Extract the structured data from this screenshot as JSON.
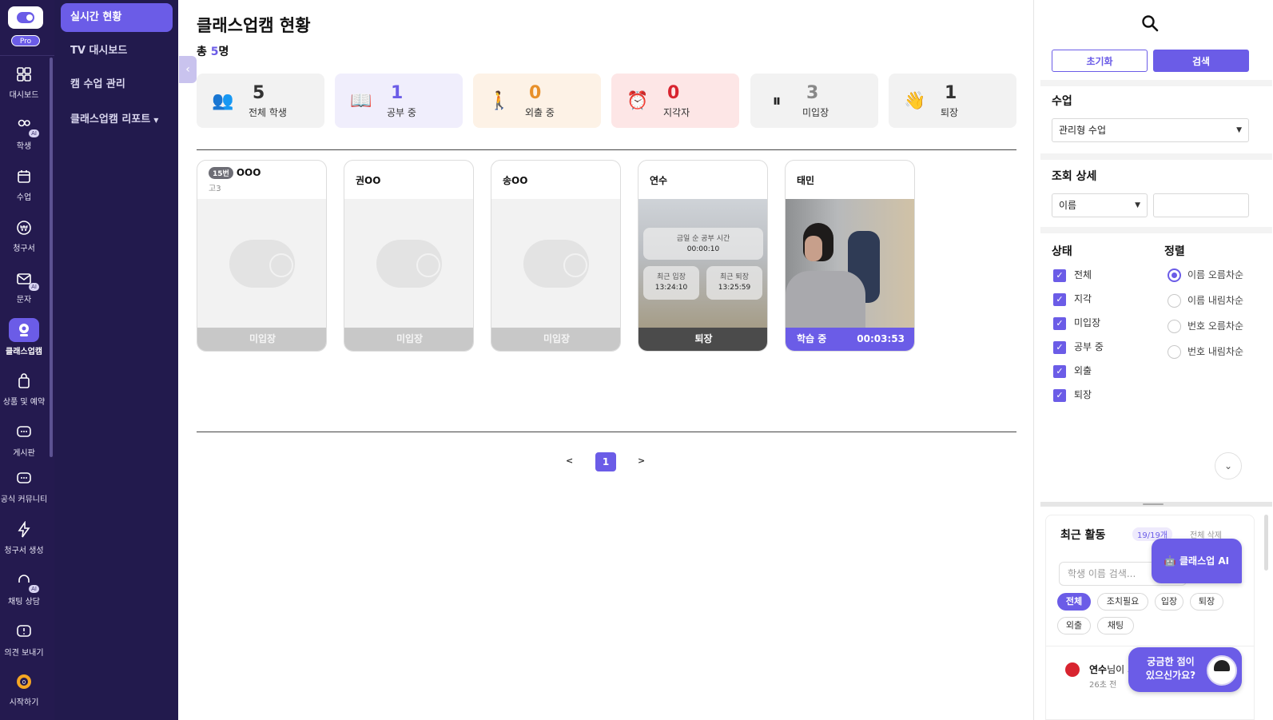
{
  "rail": {
    "pro_label": "Pro",
    "ai_label": "AI",
    "items": [
      {
        "label": "대시보드"
      },
      {
        "label": "학생"
      },
      {
        "label": "수업"
      },
      {
        "label": "청구서"
      },
      {
        "label": "문자"
      },
      {
        "label": "클래스업캠"
      },
      {
        "label": "상품 및 예약"
      },
      {
        "label": "게시판"
      },
      {
        "label": "공식 커뮤니티"
      },
      {
        "label": "청구서 생성"
      },
      {
        "label": "채팅 상담"
      },
      {
        "label": "의견 보내기"
      },
      {
        "label": "시작하기"
      }
    ]
  },
  "submenu": {
    "items": [
      {
        "label": "실시간 현황"
      },
      {
        "label": "TV 대시보드"
      },
      {
        "label": "캠 수업 관리"
      },
      {
        "label": "클래스업캠 리포트"
      }
    ]
  },
  "main": {
    "title": "클래스업캠 현황",
    "total_prefix": "총 ",
    "total_count": "5",
    "total_suffix": "명",
    "stats": [
      {
        "value": "5",
        "label": "전체 학생",
        "icon": "people-icon",
        "bg": "#f2f2f2",
        "color": "#333333"
      },
      {
        "value": "1",
        "label": "공부 중",
        "icon": "book-icon",
        "bg": "#f0eefc",
        "color": "#6b5ce7"
      },
      {
        "value": "0",
        "label": "외출 중",
        "icon": "walking-icon",
        "bg": "#fdf2e6",
        "color": "#e8902a"
      },
      {
        "value": "0",
        "label": "지각자",
        "icon": "alarm-clock-icon",
        "bg": "#fde6e6",
        "color": "#d8242f"
      },
      {
        "value": "3",
        "label": "미입장",
        "icon": "pause-icon",
        "bg": "#f2f2f2",
        "color": "#888888"
      },
      {
        "value": "1",
        "label": "퇴장",
        "icon": "waving-hand-icon",
        "bg": "#f2f2f2",
        "color": "#333333"
      }
    ],
    "cards": [
      {
        "number": "15번",
        "name": "OOO",
        "grade": "고3",
        "status": "미입장"
      },
      {
        "name": "권OO",
        "status": "미입장"
      },
      {
        "name": "송OO",
        "status": "미입장"
      },
      {
        "name": "연수",
        "status": "퇴장",
        "today_label": "금일 순 공부 시간",
        "today_value": "00:00:10",
        "in_label": "최근 입장",
        "in_value": "13:24:10",
        "out_label": "최근 퇴장",
        "out_value": "13:25:59"
      },
      {
        "name": "태민",
        "status": "학습 중",
        "timer": "00:03:53"
      }
    ],
    "pagination": {
      "prev": "<",
      "current": "1",
      "next": ">"
    }
  },
  "panel": {
    "reset_label": "초기화",
    "search_label": "검색",
    "class_title": "수업",
    "class_value": "관리형 수업",
    "detail_title": "조회 상세",
    "detail_value": "이름",
    "detail_input": "",
    "status_title": "상태",
    "status_items": [
      "전체",
      "지각",
      "미입장",
      "공부 중",
      "외출",
      "퇴장"
    ],
    "sort_title": "정렬",
    "sort_items": [
      "이름 오름차순",
      "이름 내림차순",
      "번호 오름차순",
      "번호 내림차순"
    ],
    "sort_selected": "이름 오름차순"
  },
  "recent": {
    "title": "최근 활동",
    "count": "19/19개",
    "delete_all": "전체 삭제",
    "search_placeholder": "학생 이름 검색...",
    "chips": [
      "전체",
      "조치필요",
      "입장",
      "퇴장",
      "외출",
      "채팅"
    ],
    "activity_name": "연수",
    "activity_text": "님이 퇴",
    "activity_time": "26초 전"
  },
  "floating": {
    "ai_label": "🤖 클래스업 AI",
    "help_line1": "궁금한 점이",
    "help_line2": "있으신가요?"
  },
  "colors": {
    "accent": "#6b5ce7",
    "sidebar": "#241a4f"
  }
}
